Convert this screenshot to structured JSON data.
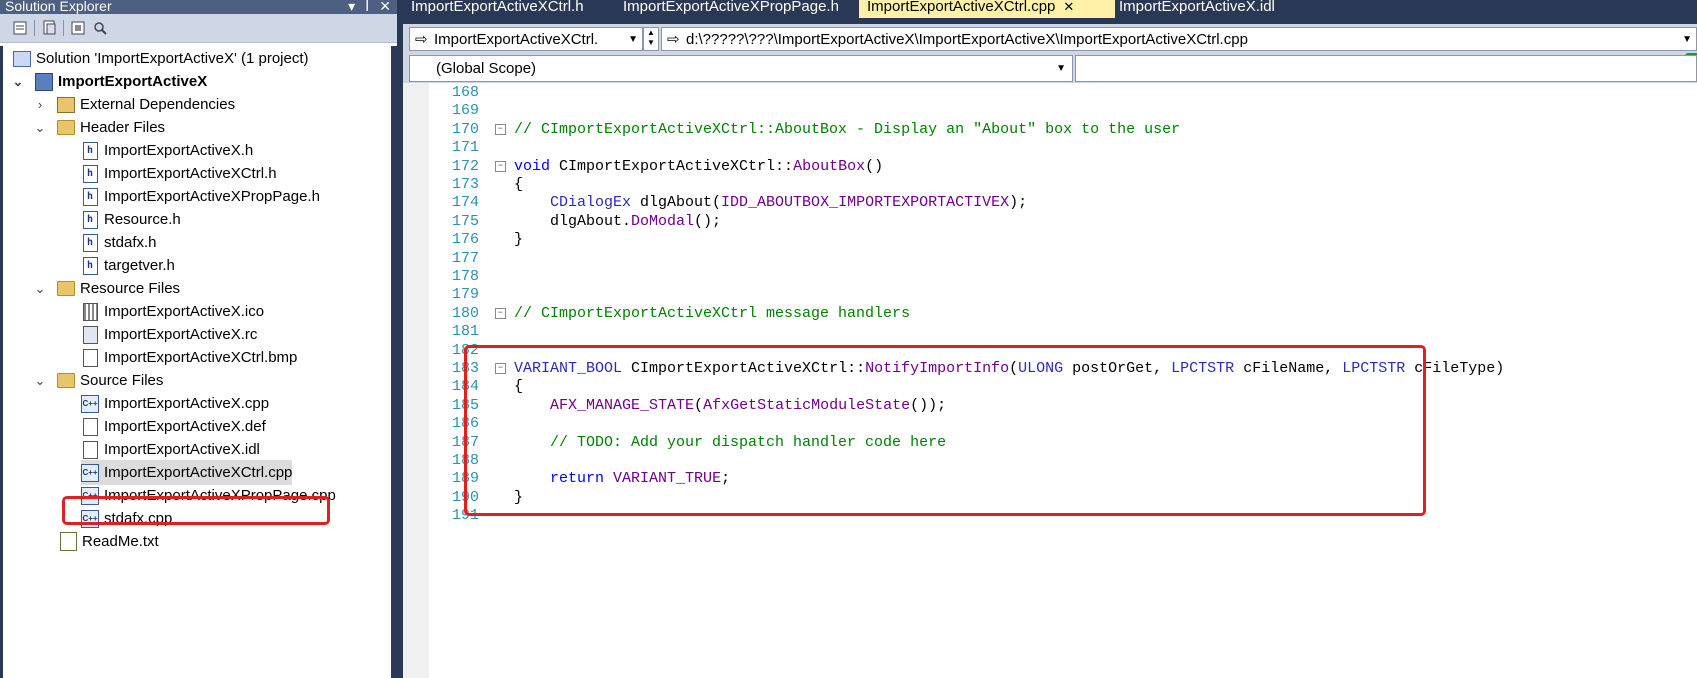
{
  "solution_explorer": {
    "title": "Solution Explorer",
    "title_controls": [
      "▾",
      "ꟾ",
      "✕"
    ],
    "items": [
      {
        "label": "Solution 'ImportExportActiveX' (1 project)",
        "icon": "solution-icon"
      },
      {
        "label": "ImportExportActiveX",
        "icon": "project-icon",
        "bold": true
      },
      {
        "label": "External Dependencies",
        "icon": "dependencies-icon"
      },
      {
        "label": "Header Files",
        "icon": "folder-icon"
      },
      {
        "label": "ImportExportActiveX.h",
        "icon": "header-file-icon"
      },
      {
        "label": "ImportExportActiveXCtrl.h",
        "icon": "header-file-icon"
      },
      {
        "label": "ImportExportActiveXPropPage.h",
        "icon": "header-file-icon"
      },
      {
        "label": "Resource.h",
        "icon": "header-file-icon"
      },
      {
        "label": "stdafx.h",
        "icon": "header-file-icon"
      },
      {
        "label": "targetver.h",
        "icon": "header-file-icon"
      },
      {
        "label": "Resource Files",
        "icon": "folder-icon"
      },
      {
        "label": "ImportExportActiveX.ico",
        "icon": "icon-file-icon"
      },
      {
        "label": "ImportExportActiveX.rc",
        "icon": "resource-file-icon"
      },
      {
        "label": "ImportExportActiveXCtrl.bmp",
        "icon": "bitmap-file-icon"
      },
      {
        "label": "Source Files",
        "icon": "folder-icon"
      },
      {
        "label": "ImportExportActiveX.cpp",
        "icon": "cpp-file-icon"
      },
      {
        "label": "ImportExportActiveX.def",
        "icon": "def-file-icon"
      },
      {
        "label": "ImportExportActiveX.idl",
        "icon": "idl-file-icon"
      },
      {
        "label": "ImportExportActiveXCtrl.cpp",
        "icon": "cpp-file-icon",
        "selected": true
      },
      {
        "label": "ImportExportActiveXPropPage.cpp",
        "icon": "cpp-file-icon"
      },
      {
        "label": "stdafx.cpp",
        "icon": "cpp-file-icon"
      },
      {
        "label": "ReadMe.txt",
        "icon": "text-file-icon"
      }
    ]
  },
  "tabs": [
    {
      "label": "ImportExportActiveXCtrl.h",
      "active": false
    },
    {
      "label": "ImportExportActiveXPropPage.h",
      "active": false
    },
    {
      "label": "ImportExportActiveXCtrl.cpp",
      "active": true,
      "close": "✕"
    },
    {
      "label": "ImportExportActiveX.idl",
      "active": false
    }
  ],
  "nav": {
    "class_dropdown": "ImportExportActiveXCtrl.",
    "path_dropdown": "d:\\?????\\???\\ImportExportActiveX\\ImportExportActiveX\\ImportExportActiveXCtrl.cpp",
    "scope_dropdown": "(Global Scope)"
  },
  "code_lines": [
    {
      "n": "168",
      "text": ""
    },
    {
      "n": "169",
      "text": ""
    },
    {
      "n": "170",
      "text": "// CImportExportActiveXCtrl::AboutBox - Display an \"About\" box to the user"
    },
    {
      "n": "171",
      "text": ""
    },
    {
      "n": "172",
      "text": "void CImportExportActiveXCtrl::AboutBox()"
    },
    {
      "n": "173",
      "text": "{"
    },
    {
      "n": "174",
      "text": "    CDialogEx dlgAbout(IDD_ABOUTBOX_IMPORTEXPORTACTIVEX);"
    },
    {
      "n": "175",
      "text": "    dlgAbout.DoModal();"
    },
    {
      "n": "176",
      "text": "}"
    },
    {
      "n": "177",
      "text": ""
    },
    {
      "n": "178",
      "text": ""
    },
    {
      "n": "179",
      "text": ""
    },
    {
      "n": "180",
      "text": "// CImportExportActiveXCtrl message handlers"
    },
    {
      "n": "181",
      "text": ""
    },
    {
      "n": "182",
      "text": ""
    },
    {
      "n": "183",
      "text": "VARIANT_BOOL CImportExportActiveXCtrl::NotifyImportInfo(ULONG postOrGet, LPCTSTR cFileName, LPCTSTR cFileType)"
    },
    {
      "n": "184",
      "text": "{"
    },
    {
      "n": "185",
      "text": "    AFX_MANAGE_STATE(AfxGetStaticModuleState());"
    },
    {
      "n": "186",
      "text": ""
    },
    {
      "n": "187",
      "text": "    // TODO: Add your dispatch handler code here"
    },
    {
      "n": "188",
      "text": ""
    },
    {
      "n": "189",
      "text": "    return VARIANT_TRUE;"
    },
    {
      "n": "190",
      "text": "}"
    },
    {
      "n": "191",
      "text": ""
    }
  ],
  "colors": {
    "highlight_border": "#e02020",
    "active_tab": "#fff2a8",
    "chrome": "#293955",
    "line_number": "#2b91af",
    "keyword": "#0000ff",
    "comment": "#008000",
    "macro": "#6f008a",
    "function": "#880000"
  }
}
